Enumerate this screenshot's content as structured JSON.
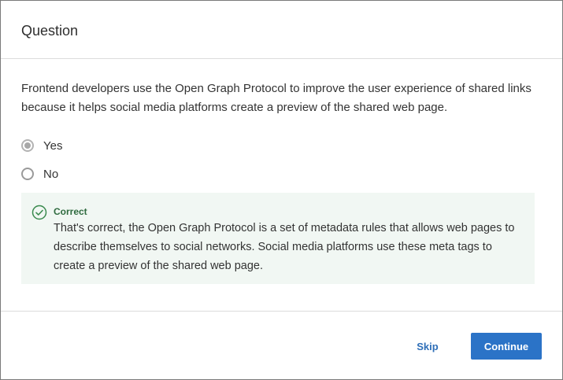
{
  "dialog": {
    "title": "Question"
  },
  "question": {
    "text": "Frontend developers use the Open Graph Protocol to improve the user experience of shared links because it helps social media platforms create a preview of the shared web page."
  },
  "options": [
    {
      "label": "Yes",
      "selected": true
    },
    {
      "label": "No",
      "selected": false
    }
  ],
  "feedback": {
    "status": "Correct",
    "icon": "check-circle-icon",
    "text": "That's correct, the Open Graph Protocol is a set of metadata rules that allows web pages to describe themselves to social networks. Social media platforms use these meta tags to create a preview of the shared web page.",
    "color": "#2f6b3f",
    "background": "#f1f7f3"
  },
  "footer": {
    "skip_label": "Skip",
    "continue_label": "Continue",
    "accent": "#2b73c7"
  }
}
